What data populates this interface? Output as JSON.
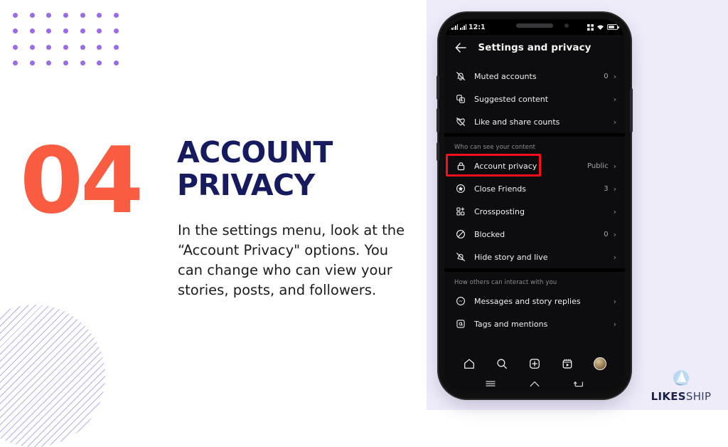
{
  "slide": {
    "number": "04",
    "headline_line1": "ACCOUNT",
    "headline_line2": "PRIVACY",
    "body": "In the settings menu, look at the “Account Privacy\" options. You can change who can view your stories, posts, and followers.",
    "accent_color": "#f95c40",
    "headline_color": "#161a5e",
    "right_bg_color": "#efecfa",
    "dot_color": "#9b6ce8"
  },
  "brand": {
    "name_bold": "LIKES",
    "name_light": "SHIP",
    "mark": "sailboat-icon"
  },
  "phone": {
    "status": {
      "time": "12:1",
      "signal_icon": "signal-bars-icon",
      "signal_icon_2": "signal-bars-icon",
      "data_icon": "mobile-data-icon",
      "wifi_icon": "wifi-icon",
      "battery_icon": "battery-icon"
    },
    "header": {
      "back_icon": "back-arrow-icon",
      "title": "Settings and privacy"
    },
    "sections": [
      {
        "heading": "",
        "rows": [
          {
            "icon": "muted-bell-icon",
            "label": "Muted accounts",
            "value": "0",
            "chevron": "›",
            "highlighted": false
          },
          {
            "icon": "suggested-icon",
            "label": "Suggested content",
            "value": "",
            "chevron": "›",
            "highlighted": false
          },
          {
            "icon": "heart-off-icon",
            "label": "Like and share counts",
            "value": "",
            "chevron": "›",
            "highlighted": false
          }
        ]
      },
      {
        "heading": "Who can see your content",
        "rows": [
          {
            "icon": "lock-icon",
            "label": "Account privacy",
            "value": "Public",
            "chevron": "›",
            "highlighted": true
          },
          {
            "icon": "star-circle-icon",
            "label": "Close Friends",
            "value": "3",
            "chevron": "›",
            "highlighted": false
          },
          {
            "icon": "crossposting-icon",
            "label": "Crossposting",
            "value": "",
            "chevron": "›",
            "highlighted": false
          },
          {
            "icon": "blocked-icon",
            "label": "Blocked",
            "value": "0",
            "chevron": "›",
            "highlighted": false
          },
          {
            "icon": "hide-story-icon",
            "label": "Hide story and live",
            "value": "",
            "chevron": "›",
            "highlighted": false
          }
        ]
      },
      {
        "heading": "How others can interact with you",
        "rows": [
          {
            "icon": "messenger-icon",
            "label": "Messages and story replies",
            "value": "",
            "chevron": "›",
            "highlighted": false
          },
          {
            "icon": "tags-at-icon",
            "label": "Tags and mentions",
            "value": "",
            "chevron": "›",
            "highlighted": false
          }
        ]
      }
    ],
    "bottom_nav": [
      {
        "icon": "home-icon"
      },
      {
        "icon": "search-icon"
      },
      {
        "icon": "add-post-icon"
      },
      {
        "icon": "reels-icon"
      },
      {
        "icon": "profile-avatar"
      }
    ],
    "android_nav": [
      {
        "icon": "recents-icon"
      },
      {
        "icon": "home-button-icon"
      },
      {
        "icon": "back-button-icon"
      }
    ],
    "highlight_color": "#fc0d1b"
  }
}
